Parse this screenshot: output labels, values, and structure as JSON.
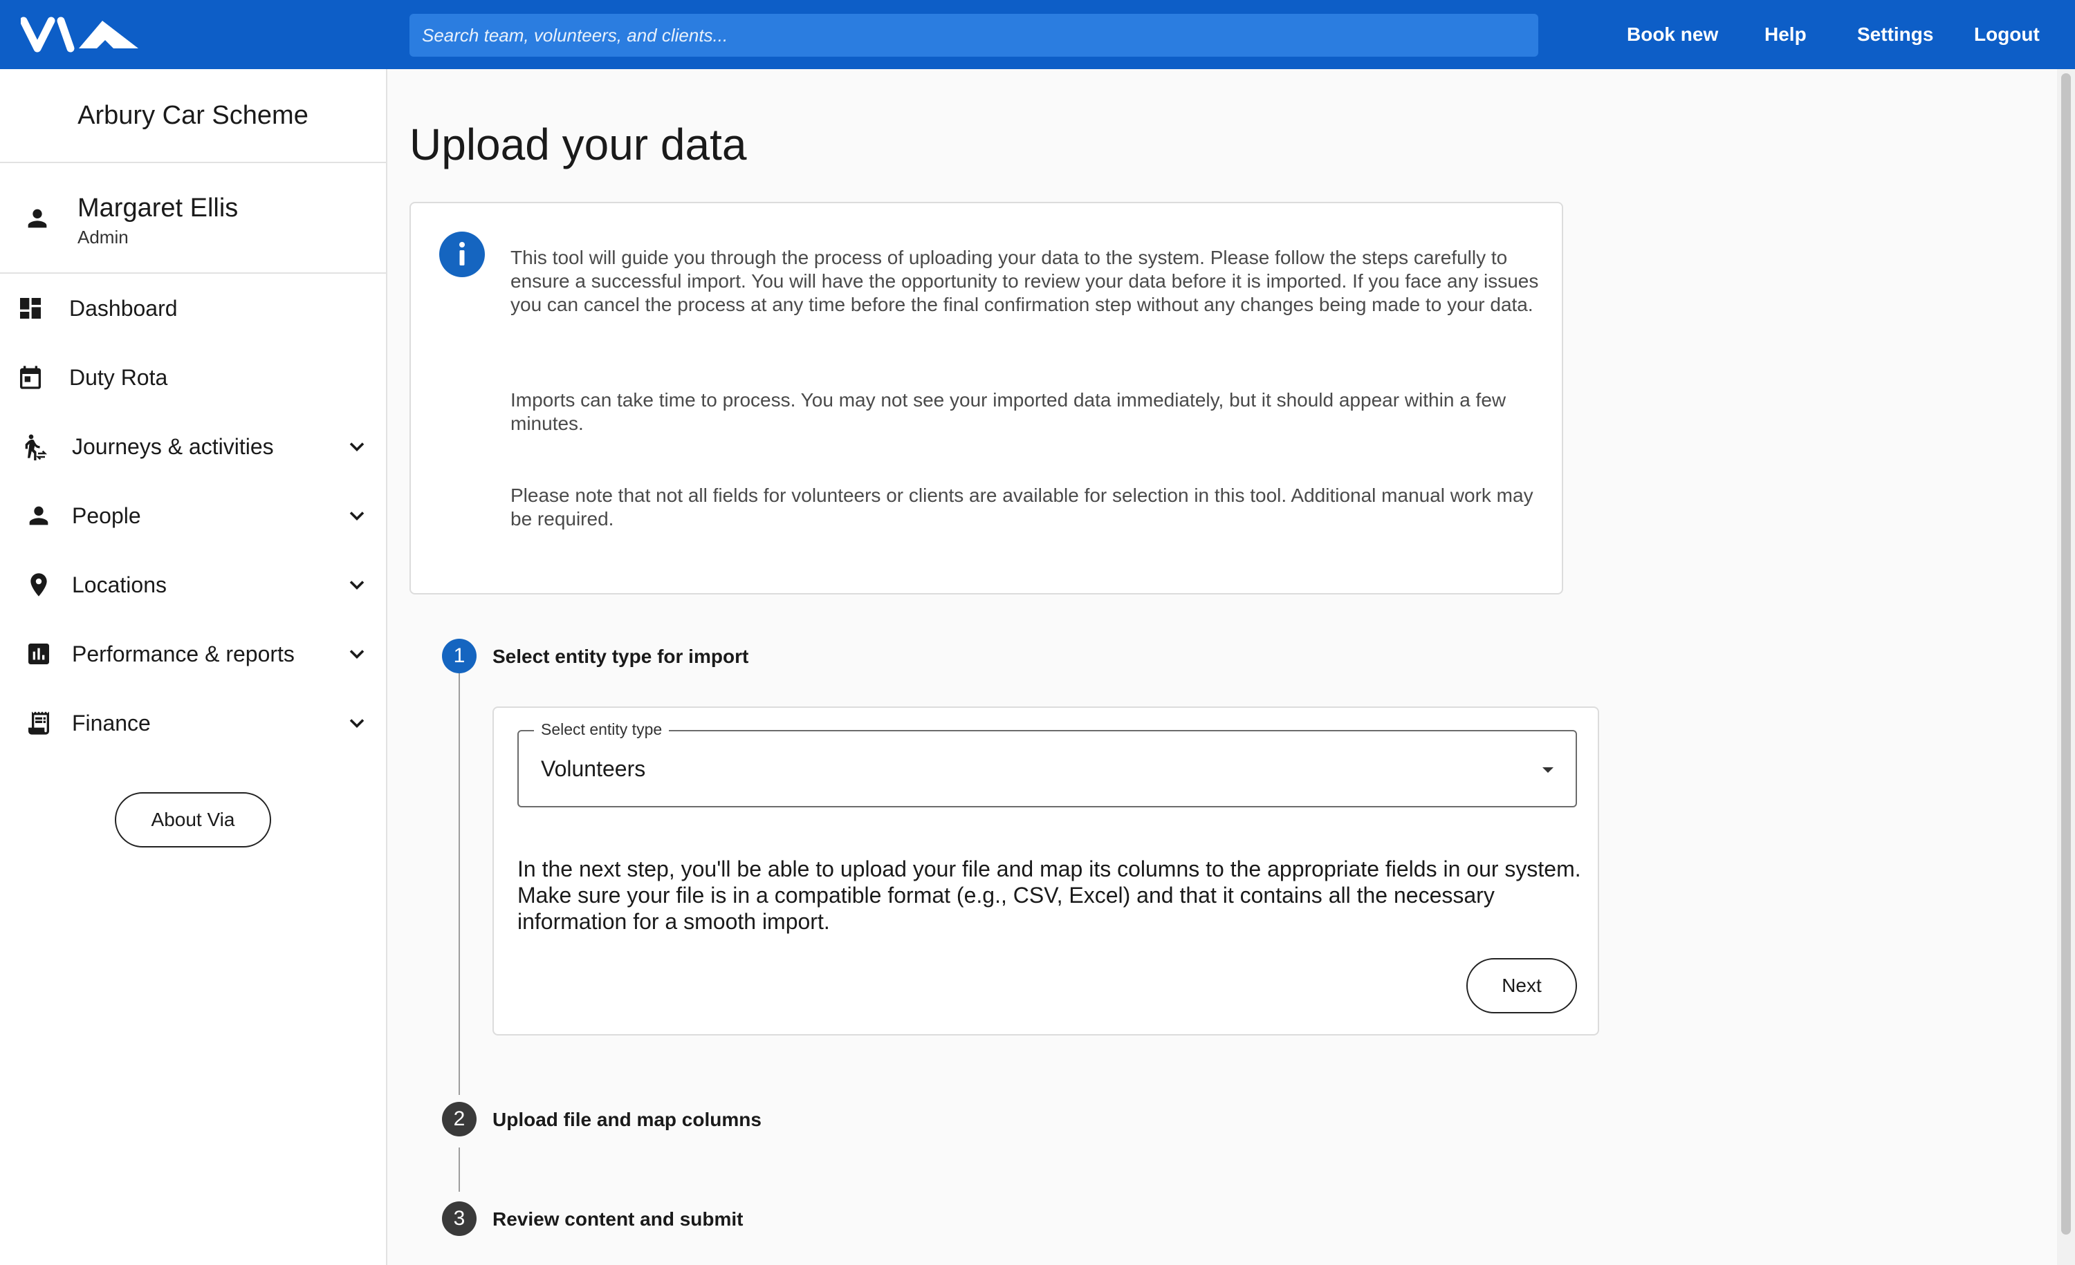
{
  "topbar": {
    "logo_name": "via-logo",
    "search_placeholder": "Search team, volunteers, and clients...",
    "nav": [
      "Book new",
      "Help",
      "Settings",
      "Logout"
    ],
    "color": "#0d5ec7"
  },
  "sidebar": {
    "org": "Arbury Car Scheme",
    "user": {
      "name": "Margaret Ellis",
      "role": "Admin"
    },
    "items": [
      {
        "label": "Dashboard",
        "icon": "dashboard-icon"
      },
      {
        "label": "Duty Rota",
        "icon": "calendar-icon"
      },
      {
        "label": "Journeys & activities",
        "icon": "journey-icon",
        "expandable": true
      },
      {
        "label": "People",
        "icon": "person-icon",
        "expandable": true
      },
      {
        "label": "Locations",
        "icon": "location-pin-icon",
        "expandable": true
      },
      {
        "label": "Performance & reports",
        "icon": "bar-chart-icon",
        "expandable": true
      },
      {
        "label": "Finance",
        "icon": "receipt-icon",
        "expandable": true
      }
    ],
    "about_label": "About Via"
  },
  "main": {
    "title": "Upload your data",
    "info": [
      "This tool will guide you through the process of uploading your data to the system. Please follow the steps carefully to ensure a successful import. You will have the opportunity to review your data before it is imported. If you face any issues you can cancel the process at any time before the final confirmation step without any changes being made to your data.",
      "Imports can take time to process. You may not see your imported data immediately, but it should appear within a few minutes.",
      "Please note that not all fields for volunteers or clients are available for selection in this tool. Additional manual work may be required."
    ],
    "steps": [
      {
        "number": "1",
        "label": "Select entity type for import",
        "active": true
      },
      {
        "number": "2",
        "label": "Upload file and map columns",
        "active": false
      },
      {
        "number": "3",
        "label": "Review content and submit",
        "active": false
      }
    ],
    "step1": {
      "select_label": "Select entity type",
      "select_value": "Volunteers",
      "text": "In the next step, you'll be able to upload your file and map its columns to the appropriate fields in our system. Make sure your file is in a compatible format (e.g., CSV, Excel) and that it contains all the necessary information for a smooth import.",
      "next_label": "Next"
    }
  }
}
